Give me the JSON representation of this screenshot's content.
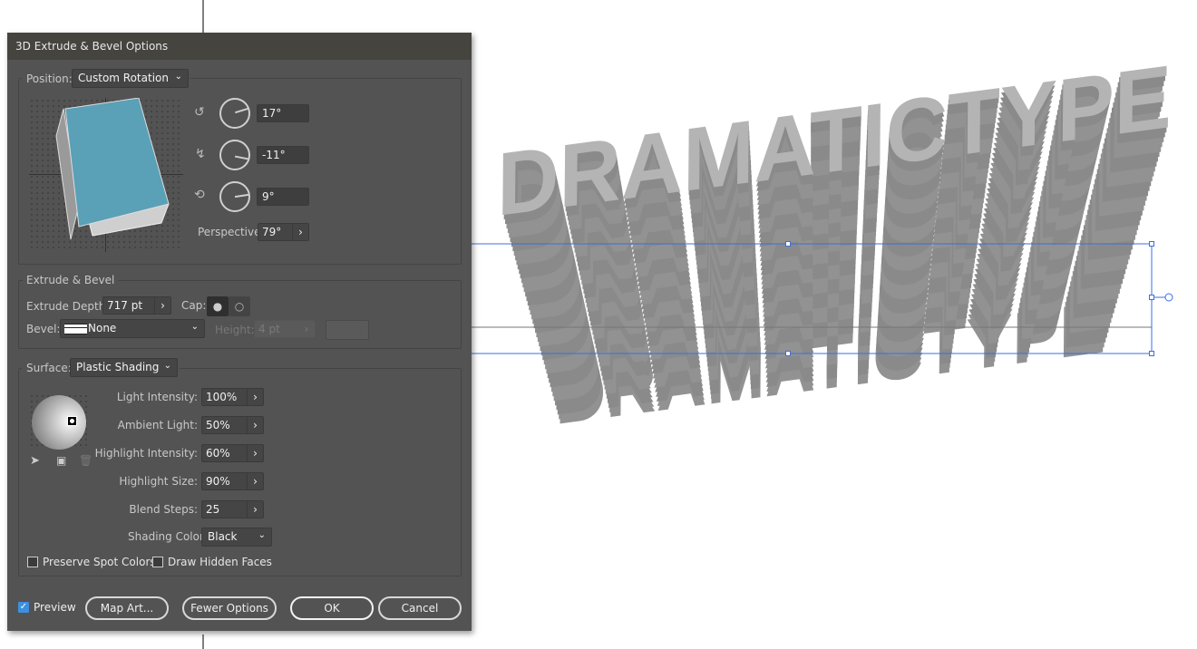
{
  "canvas": {
    "art_text": "DRAMATICTYPE",
    "face_color": "#b4b4b4",
    "side_color": "#8c8c8c",
    "selection_color": "#3b6fe0"
  },
  "dialog": {
    "title": "3D Extrude & Bevel Options",
    "position": {
      "label": "Position:",
      "value": "Custom Rotation",
      "x_rotation": "17°",
      "y_rotation": "-11°",
      "z_rotation": "9°",
      "perspective_label": "Perspective:",
      "perspective": "79°",
      "cube_color": "#5aa0b7"
    },
    "extrude": {
      "section": "Extrude & Bevel",
      "depth_label": "Extrude Depth:",
      "depth": "717 pt",
      "cap_label": "Cap:",
      "bevel_label": "Bevel:",
      "bevel": "None",
      "height_label": "Height:",
      "height": "4 pt"
    },
    "surface": {
      "label": "Surface:",
      "value": "Plastic Shading",
      "fields": [
        {
          "label": "Light Intensity:",
          "value": "100%"
        },
        {
          "label": "Ambient Light:",
          "value": "50%"
        },
        {
          "label": "Highlight Intensity:",
          "value": "60%"
        },
        {
          "label": "Highlight Size:",
          "value": "90%"
        },
        {
          "label": "Blend Steps:",
          "value": "25"
        }
      ],
      "shading_color_label": "Shading Color:",
      "shading_color": "Black",
      "preserve_spot": "Preserve Spot Colors",
      "preserve_spot_checked": false,
      "draw_hidden": "Draw Hidden Faces",
      "draw_hidden_checked": false
    },
    "footer": {
      "preview": "Preview",
      "preview_checked": true,
      "map_art": "Map Art...",
      "fewer": "Fewer Options",
      "ok": "OK",
      "cancel": "Cancel"
    }
  }
}
